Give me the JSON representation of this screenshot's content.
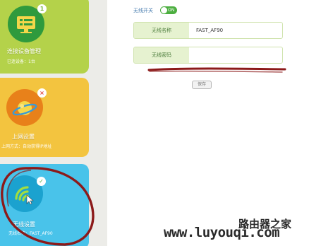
{
  "sidebar": {
    "devices": {
      "title": "连接设备管理",
      "subtitle": "已连设备：1台",
      "badge": "1"
    },
    "internet": {
      "title": "上网设置",
      "subtitle": "上网方式：自动获得IP地址",
      "badge": "×"
    },
    "wireless": {
      "title": "无线设置",
      "subtitle": "无线名称：FAST_AF90",
      "badge": "✓"
    }
  },
  "wireless_settings": {
    "switch_label": "无线开关",
    "switch_state": "ON",
    "ssid_label": "无线名称",
    "ssid_value": "FAST_AF90",
    "password_label": "无线密码",
    "password_value": "",
    "save_label": "保存"
  },
  "watermark": {
    "title": "路由器之家",
    "url": "www.luyouqi.com"
  },
  "colors": {
    "green_card": "#b4d24a",
    "orange_card": "#f3c43f",
    "blue_card": "#49c3ea",
    "toggle_on": "#4cae3f",
    "annotation": "#8c1a1a"
  }
}
